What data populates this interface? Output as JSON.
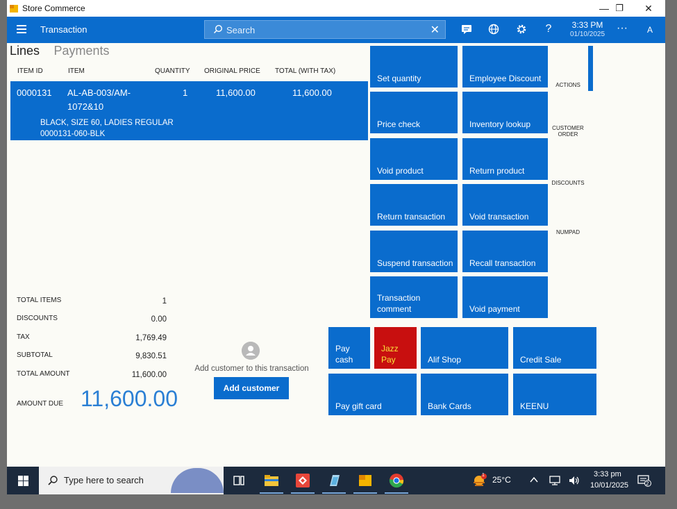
{
  "window": {
    "title": "Store Commerce",
    "controls": {
      "minimize": "—",
      "restore": "❐",
      "close": "✕"
    }
  },
  "header": {
    "title": "Transaction",
    "search_placeholder": "Search",
    "clear_glyph": "✕",
    "time": "3:33 PM",
    "date": "01/10/2025",
    "more_glyph": "···",
    "help_glyph": "?",
    "user_initial": "A",
    "icons": [
      "chat-icon",
      "globe-icon",
      "gear-icon",
      "help-icon"
    ]
  },
  "tabs": [
    {
      "label": "Lines",
      "active": true
    },
    {
      "label": "Payments",
      "active": false
    }
  ],
  "grid": {
    "columns": [
      "ITEM ID",
      "ITEM",
      "QUANTITY",
      "ORIGINAL PRICE",
      "TOTAL (WITH TAX)"
    ],
    "rows": [
      {
        "item_id": "0000131",
        "item_line1": "AL-AB-003/AM-",
        "item_line2": "1072&10",
        "quantity": "1",
        "original_price": "11,600.00",
        "total": "11,600.00",
        "variant": "BLACK, SIZE 60, LADIES REGULAR",
        "variant_code": "0000131-060-BLK"
      }
    ]
  },
  "totals": [
    {
      "label": "TOTAL ITEMS",
      "value": "1"
    },
    {
      "label": "DISCOUNTS",
      "value": "0.00"
    },
    {
      "label": "TAX",
      "value": "1,769.49"
    },
    {
      "label": "SUBTOTAL",
      "value": "9,830.51"
    },
    {
      "label": "TOTAL AMOUNT",
      "value": "11,600.00"
    }
  ],
  "amount_due": {
    "label": "AMOUNT DUE",
    "value": "11,600.00"
  },
  "customer": {
    "prompt": "Add customer to this transaction",
    "button": "Add customer"
  },
  "actions": [
    "Set quantity",
    "Employee Discount",
    "Price check",
    "Inventory lookup",
    "Void product",
    "Return product",
    "Return transaction",
    "Void transaction",
    "Suspend transaction",
    "Recall transaction",
    "Transaction comment",
    "Void payment"
  ],
  "side_tabs": [
    "ACTIONS",
    "CUSTOMER ORDER",
    "DISCOUNTS",
    "NUMPAD"
  ],
  "payments": [
    {
      "label": "Pay cash"
    },
    {
      "label": "Jazz Pay"
    },
    {
      "label": "Alif Shop"
    },
    {
      "label": "Credit Sale"
    },
    {
      "label": "Pay gift card"
    },
    {
      "label": "Bank Cards"
    },
    {
      "label": "KEENU"
    }
  ],
  "colors": {
    "accent": "#0a6ccd",
    "jazz_bg": "#c80f0f",
    "jazz_text": "#f8e33a",
    "background": "#fbfbf6"
  },
  "taskbar": {
    "search_text": "Type here to search",
    "temperature": "25°C",
    "time": "3:33 pm",
    "date": "10/01/2025",
    "notification_count": "2",
    "weather_badge": "1"
  }
}
